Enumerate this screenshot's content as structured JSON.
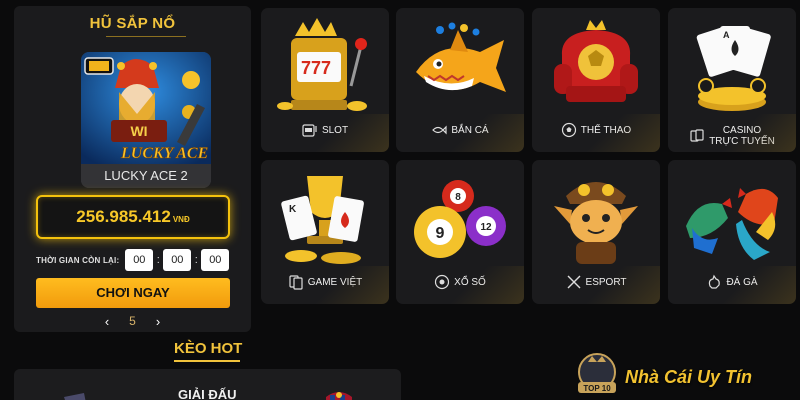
{
  "jackpot": {
    "title": "HŨ SẮP NỔ",
    "game_name": "LUCKY ACE 2",
    "amount": "256.985.412",
    "currency": "VNĐ",
    "countdown_label": "THỜI GIAN CÒN LẠI:",
    "countdown": {
      "hours": "00",
      "minutes": "00",
      "seconds": "00",
      "separator": ":"
    },
    "play_label": "CHƠI NGAY",
    "page_number": "5"
  },
  "categories": [
    {
      "label": "SLOT",
      "icon": "slot-machine-icon"
    },
    {
      "label": "BẮN CÁ",
      "icon": "fish-icon"
    },
    {
      "label": "THỂ THAO",
      "icon": "soccer-ball-icon"
    },
    {
      "label_line1": "CASINO",
      "label_line2": "TRỰC TUYẾN",
      "icon": "playing-cards-icon"
    },
    {
      "label": "GAME VIỆT",
      "icon": "card-game-icon"
    },
    {
      "label": "XỔ SỐ",
      "icon": "lottery-ball-icon"
    },
    {
      "label": "ESPORT",
      "icon": "crossed-swords-icon"
    },
    {
      "label": "ĐÁ GÀ",
      "icon": "rooster-icon"
    }
  ],
  "hot": {
    "title": "KÈO HOT",
    "league_label": "GIẢI ĐẤU"
  },
  "watermark": {
    "brand": "Nhà Cái Uy Tín",
    "badge": "TOP 10"
  },
  "colors": {
    "accent_gold": "#f1c33c",
    "button_orange": "#f7a813",
    "panel_bg": "#1b1b1d",
    "page_bg": "#0b0b0c"
  }
}
